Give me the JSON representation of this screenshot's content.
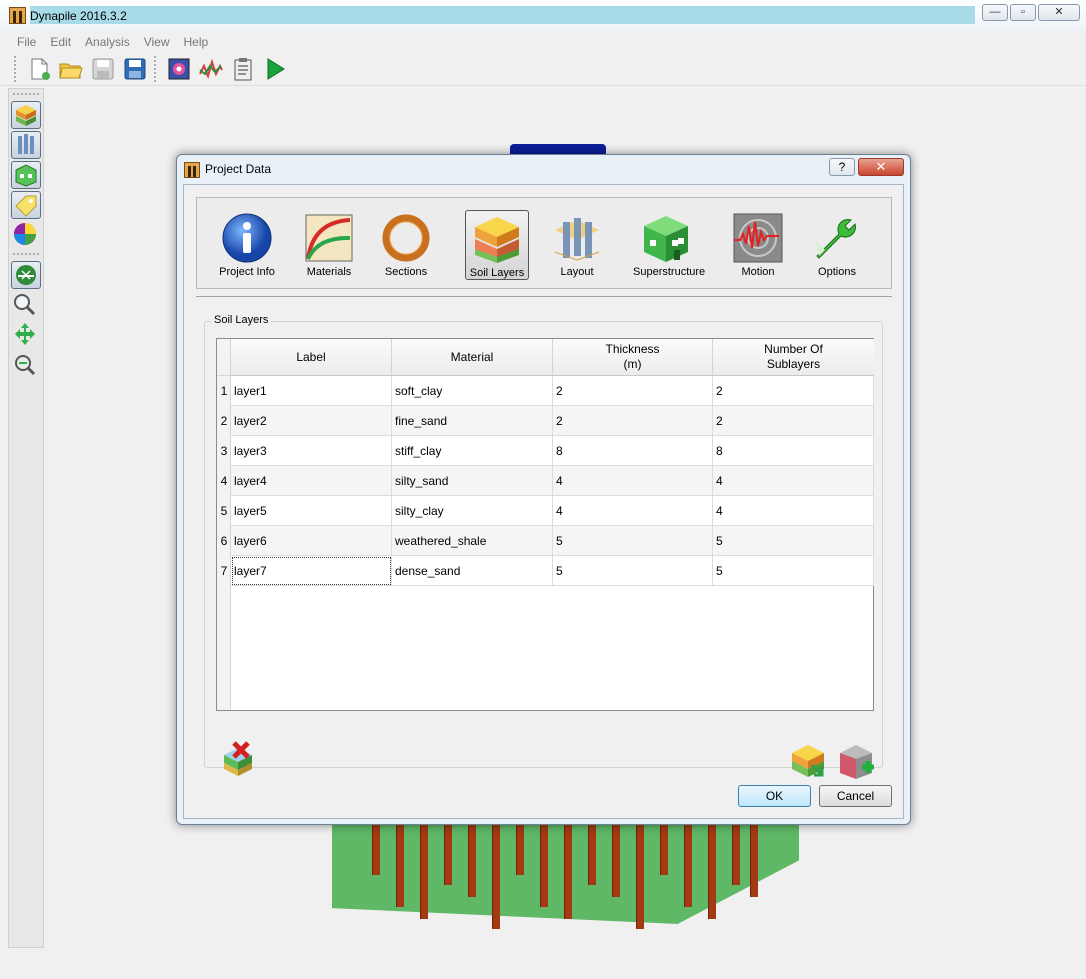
{
  "window": {
    "title": "Dynapile 2016.3.2",
    "minimize": "—",
    "maximize": "▫",
    "close": "✕"
  },
  "menu": [
    "File",
    "Edit",
    "Analysis",
    "View",
    "Help"
  ],
  "dialog": {
    "title": "Project Data",
    "help": "?",
    "close": "✕",
    "nav": [
      {
        "label": "Project Info",
        "icon": "info-icon"
      },
      {
        "label": "Materials",
        "icon": "materials-chart-icon"
      },
      {
        "label": "Sections",
        "icon": "ring-section-icon"
      },
      {
        "label": "Soil Layers",
        "icon": "soil-layers-icon",
        "active": true
      },
      {
        "label": "Layout",
        "icon": "pile-layout-icon"
      },
      {
        "label": "Superstructure",
        "icon": "building-icon"
      },
      {
        "label": "Motion",
        "icon": "seismic-wave-icon"
      },
      {
        "label": "Options",
        "icon": "wrench-icon"
      }
    ],
    "group_title": "Soil Layers",
    "table": {
      "headers": [
        "Label",
        "Material",
        "Thickness\n(m)",
        "Number Of\nSublayers"
      ],
      "header_lines": [
        [
          "Label"
        ],
        [
          "Material"
        ],
        [
          "Thickness",
          "(m)"
        ],
        [
          "Number Of",
          "Sublayers"
        ]
      ],
      "rows": [
        {
          "n": "1",
          "label": "layer1",
          "material": "soft_clay",
          "thickness": "2",
          "sublayers": "2"
        },
        {
          "n": "2",
          "label": "layer2",
          "material": "fine_sand",
          "thickness": "2",
          "sublayers": "2"
        },
        {
          "n": "3",
          "label": "layer3",
          "material": "stiff_clay",
          "thickness": "8",
          "sublayers": "8"
        },
        {
          "n": "4",
          "label": "layer4",
          "material": "silty_sand",
          "thickness": "4",
          "sublayers": "4"
        },
        {
          "n": "5",
          "label": "layer5",
          "material": "silty_clay",
          "thickness": "4",
          "sublayers": "4"
        },
        {
          "n": "6",
          "label": "layer6",
          "material": "weathered_shale",
          "thickness": "5",
          "sublayers": "5"
        },
        {
          "n": "7",
          "label": "layer7",
          "material": "dense_sand",
          "thickness": "5",
          "sublayers": "5"
        }
      ]
    },
    "ok": "OK",
    "cancel": "Cancel"
  },
  "colors": {
    "accent": "#3c7fb1",
    "title_bar": "#a7dbe8",
    "pile": "#a33a13",
    "pile_cap": "#5fb866",
    "cap_blue": "#0b1e9a"
  }
}
